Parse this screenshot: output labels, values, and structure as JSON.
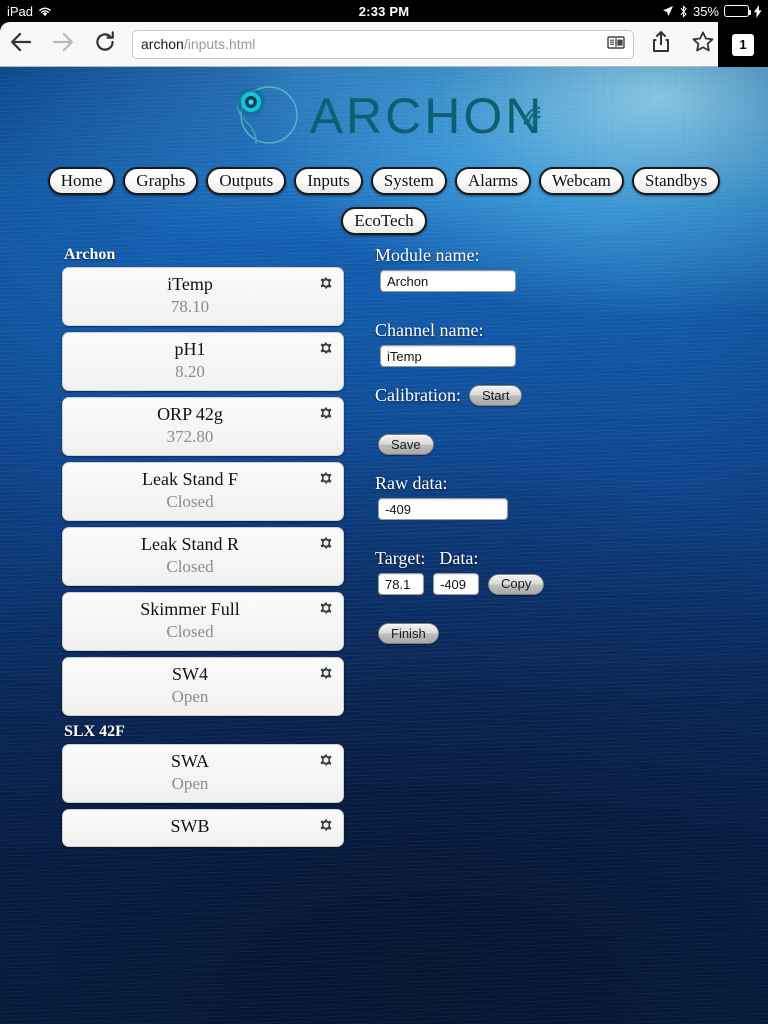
{
  "status_bar": {
    "carrier": "iPad",
    "wifi_icon": "wifi-icon",
    "time": "2:33 PM",
    "location_icon": "location-arrow-icon",
    "bluetooth_icon": "bluetooth-icon",
    "battery_percent": "35%",
    "battery_level": 35,
    "charging_icon": "lightning-bolt-icon"
  },
  "browser": {
    "back_icon": "back-arrow-icon",
    "forward_icon": "forward-arrow-icon",
    "reload_icon": "reload-icon",
    "url_domain": "archon",
    "url_path": "/inputs.html",
    "reader_icon": "reader-view-icon",
    "share_icon": "share-icon",
    "bookmark_icon": "star-icon",
    "tab_count": "1"
  },
  "logo": {
    "word": "ARCHON",
    "mark_icon": "archon-circle-logo-icon",
    "wifi_icon": "signal-waves-icon",
    "color": "#0e5f72"
  },
  "nav": {
    "row1": [
      {
        "label": "Home",
        "name": "nav-home"
      },
      {
        "label": "Graphs",
        "name": "nav-graphs"
      },
      {
        "label": "Outputs",
        "name": "nav-outputs"
      },
      {
        "label": "Inputs",
        "name": "nav-inputs"
      },
      {
        "label": "System",
        "name": "nav-system"
      },
      {
        "label": "Alarms",
        "name": "nav-alarms"
      },
      {
        "label": "Webcam",
        "name": "nav-webcam"
      },
      {
        "label": "Standbys",
        "name": "nav-standbys"
      }
    ],
    "row2": [
      {
        "label": "EcoTech",
        "name": "nav-ecotech"
      }
    ]
  },
  "inputs_list": {
    "groups": [
      {
        "header": "Archon",
        "items": [
          {
            "name": "iTemp",
            "value": "78.10"
          },
          {
            "name": "pH1",
            "value": "8.20"
          },
          {
            "name": "ORP 42g",
            "value": "372.80"
          },
          {
            "name": "Leak Stand F",
            "value": "Closed"
          },
          {
            "name": "Leak Stand R",
            "value": "Closed"
          },
          {
            "name": "Skimmer Full",
            "value": "Closed"
          },
          {
            "name": "SW4",
            "value": "Open"
          }
        ]
      },
      {
        "header": "SLX 42F",
        "items": [
          {
            "name": "SWA",
            "value": "Open"
          },
          {
            "name": "SWB",
            "value": ""
          }
        ]
      }
    ],
    "gear_icon": "gear-icon"
  },
  "form": {
    "module_label": "Module name:",
    "module_value": "Archon",
    "channel_label": "Channel name:",
    "channel_value": "iTemp",
    "calibration_label": "Calibration:",
    "start_button": "Start",
    "save_button": "Save",
    "raw_label": "Raw data:",
    "raw_value": "-409",
    "target_label": "Target:",
    "data_label": "Data:",
    "target_value": "78.1",
    "data_value": "-409",
    "copy_button": "Copy",
    "finish_button": "Finish"
  }
}
